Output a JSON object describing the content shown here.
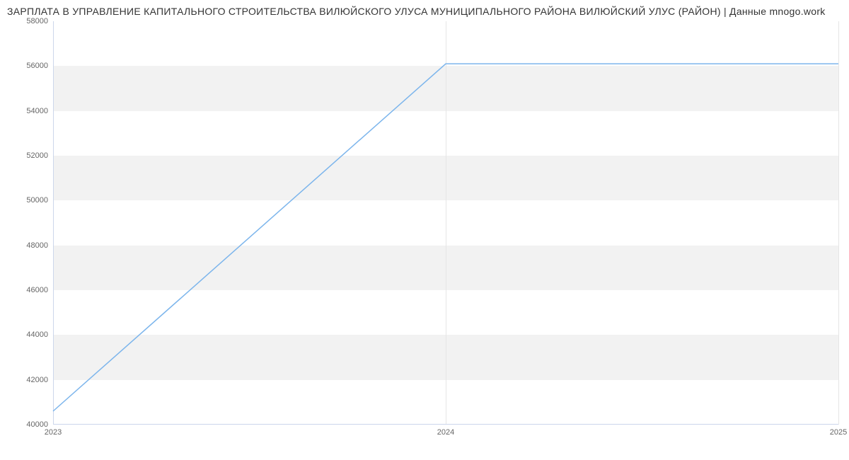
{
  "chart_data": {
    "type": "line",
    "title": "ЗАРПЛАТА В УПРАВЛЕНИЕ КАПИТАЛЬНОГО СТРОИТЕЛЬСТВА ВИЛЮЙСКОГО УЛУСА МУНИЦИПАЛЬНОГО РАЙОНА ВИЛЮЙСКИЙ УЛУС (РАЙОН) | Данные mnogo.work",
    "categories": [
      "2023",
      "2024",
      "2025"
    ],
    "values": [
      40600,
      56100,
      56100
    ],
    "xlabel": "",
    "ylabel": "",
    "ylim": [
      40000,
      58000
    ],
    "y_ticks": [
      40000,
      42000,
      44000,
      46000,
      48000,
      50000,
      52000,
      54000,
      56000,
      58000
    ]
  },
  "colors": {
    "line": "#7cb5ec",
    "band": "#f2f2f2",
    "axis": "#ccd6eb"
  }
}
